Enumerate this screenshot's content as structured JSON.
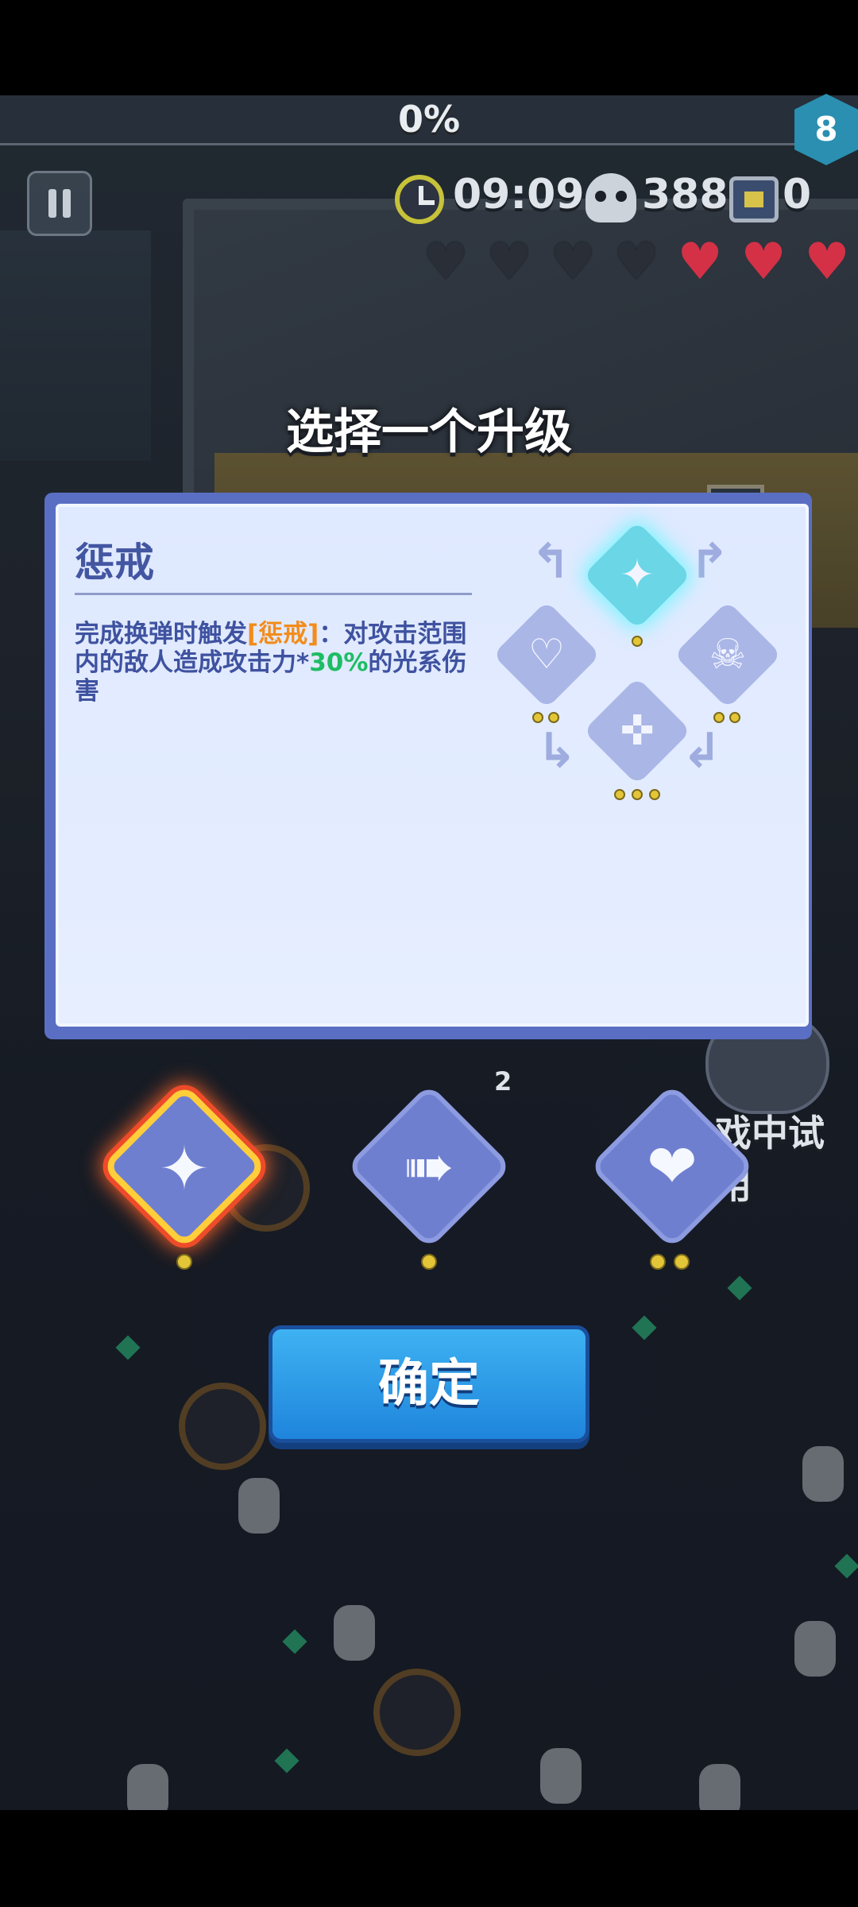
{
  "hud": {
    "progress_text": "0%",
    "level": "8",
    "timer": "09:09",
    "kills": "388",
    "chests": "0",
    "hearts": {
      "empty": 4,
      "full": 3
    },
    "icons": [
      "pause-icon",
      "clock-icon",
      "skull-icon",
      "chest-icon",
      "heart-icon"
    ]
  },
  "dialog": {
    "title": "选择一个升级",
    "skill_name": "惩戒",
    "description": {
      "part1": "完成换弹时触发",
      "highlight1": "[惩戒]",
      "part2": "：对攻击范围内的敌人造成攻击力*",
      "highlight2": "30%",
      "part3": "的光系伤害"
    },
    "highlight_colors": {
      "keyword": "#f28c1b",
      "value": "#1ebd63"
    },
    "tree_nodes": [
      {
        "icon": "holy-rocket-icon",
        "dots": 1,
        "active": true
      },
      {
        "icon": "ghost-heart-icon",
        "dots": 2,
        "active": false
      },
      {
        "icon": "skull-target-icon",
        "dots": 2,
        "active": false
      },
      {
        "icon": "heart-skull-icon",
        "dots": 3,
        "active": false
      }
    ]
  },
  "options": [
    {
      "icon": "holy-rocket-icon",
      "dots": 1,
      "selected": true
    },
    {
      "icon": "dash-boot-icon",
      "dots": 1,
      "selected": false
    },
    {
      "icon": "broken-heart-fist-icon",
      "dots": 2,
      "selected": false
    }
  ],
  "confirm_button": {
    "label": "确定",
    "color": "#2a9ae8"
  },
  "world": {
    "trial_label": "戏中试用",
    "ammo": "2"
  }
}
